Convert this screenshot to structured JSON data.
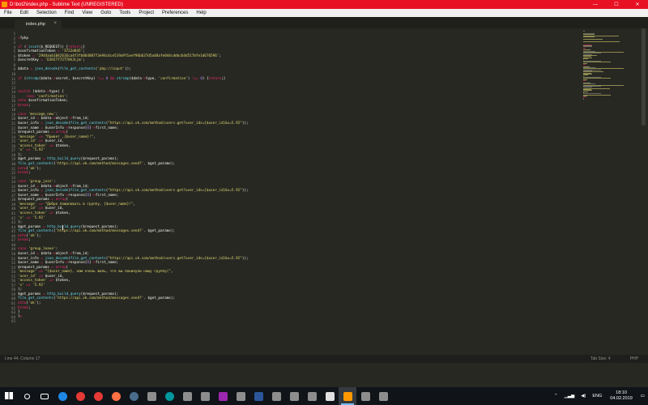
{
  "window": {
    "title": "D:\\bot2\\index.php - Sublime Text (UNREGISTERED)",
    "controls": [
      "—",
      "☐",
      "✕"
    ]
  },
  "menu": [
    "File",
    "Edit",
    "Selection",
    "Find",
    "View",
    "Goto",
    "Tools",
    "Project",
    "Preferences",
    "Help"
  ],
  "tab": {
    "label": "index.php",
    "close": "×"
  },
  "colors": {
    "background": "#272822",
    "text": "#f8f8f2",
    "keyword": "#f92672",
    "string": "#e6db74",
    "function": "#66d9ef",
    "variable": "#a6e22e",
    "number": "#ae81ff",
    "comment": "#75715e",
    "titlebar": "#e81123"
  },
  "code": {
    "start_line": 1,
    "lines": [
      "",
      "<?php",
      "",
      "if (!isset($_REQUEST)) {return;}",
      "$confirmationToken = '3722d045';",
      "$token = '2944aab1042616ca4f3fb064807f3e94c6ce519a9f1eef96b637d5a48afe044cddbc64d517bfe1d676596';",
      "$secretKey = 'DJHI7772T70hJLjm';",
      "",
      "$data = json_decode(file_get_contents('php://input'));",
      "",
      "if (strcmp($data->secret, $secretKey) !== 0 && strcmp($data->type, 'confirmation') !== 0) {return;}",
      "",
      "",
      "switch ($data->type) {",
      "    case 'confirmation':",
      "echo $confirmationToken;",
      "break;",
      "",
      "case 'message_new':",
      "$user_id = $data->object->from_id;",
      "$user_info = json_decode(file_get_contents(\"https://api.vk.com/method/users.get?user_ids={$user_id}&v=5.92\"));",
      "$user_name = $userInfo->response[0]->first_name;",
      "$request_params = array(",
      "'message' => \"Привет ,{$user_name}!\",",
      "'user_id' => $user_id,",
      "'access_token' => $token,",
      "'v' => '5.92'",
      ");",
      "$get_params = http_build_query($request_params);",
      "file_get_contents('https://api.vk.com/method/messages.send?'. $get_params);",
      "echo('ok');",
      "break;",
      "",
      "case 'group_join':",
      "$user_id = $data->object->from_id;",
      "$user_info = json_decode(file_get_contents(\"https://api.vk.com/method/users.get?user_ids={$user_id}&v=5.92\"));",
      "$user_name = $userInfo->response[0]->first_name;",
      "$request_params = array(",
      "'message' => \"Добро пожаловать в группу, {$user_name}!\",",
      "'user_id' => $user_id,",
      "'access_token' => $token,",
      "'v' => '5.92'",
      ");",
      "$get_params = http_build_query($request_params);",
      "file_get_contents('https://api.vk.com/method/messages.send?'. $get_params);",
      "echo('ok');",
      "break;",
      "",
      "case 'group_leave':",
      "$user_id = $data->object->from_id;",
      "$user_info = json_decode(file_get_contents(\"https://api.vk.com/method/users.get?user_ids={$user_id}&v=5.92\"));",
      "$user_name = $userInfo->response[0]->first_name;",
      "$request_params = array(",
      "'message' => \"{$user_name}, нам очень жаль, что вы покинули нашу группу(\",",
      "'user_id' => $user_id,",
      "'access_token' => $token,",
      "'v' => '5.92'",
      ");",
      "$get_params = http_build_query($request_params);",
      "file_get_contents('https://api.vk.com/method/messages.send?'. $get_params);",
      "echo('ok');",
      "break;",
      "}",
      "?>",
      ""
    ]
  },
  "status": {
    "position": "Line 44, Column 17",
    "tab_size": "Tab Size: 4",
    "syntax": "PHP"
  },
  "taskbar": {
    "apps": [
      "start-icon",
      "search-icon",
      "task-view-icon",
      "edge-icon",
      "chrome-icon",
      "opera-icon",
      "firefox-icon",
      "steam-icon",
      "app-icon",
      "arduino-icon",
      "app-icon",
      "app-icon",
      "winrar-icon",
      "app-icon",
      "word-icon",
      "app-icon",
      "app-icon",
      "app-icon",
      "terminal-icon",
      "sublime-icon",
      "app-icon",
      "app-icon"
    ],
    "lang": "ENG",
    "time": "18:10",
    "date": "04.02.2019"
  }
}
